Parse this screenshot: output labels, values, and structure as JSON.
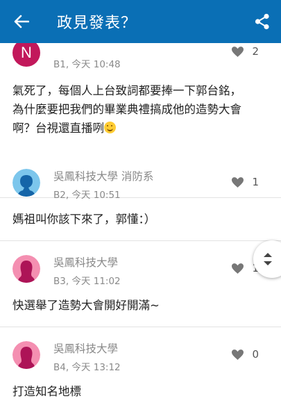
{
  "appbar": {
    "title": "政見發表？",
    "back_icon": "arrow-left-icon",
    "share_icon": "share-icon",
    "color": "#0a6fb5"
  },
  "posts": [
    {
      "avatar_type": "letter",
      "avatar_letter": "N",
      "avatar_color": "#c2185b",
      "author": "",
      "meta": "B1, 今天 10:48",
      "likes": "2",
      "lines": [
        "氣死了，每個人上台致詞都要捧一下郭台銘，",
        "為什麼要把我們的畢業典禮搞成他的造勢大會",
        "啊？台視還直播咧"
      ],
      "emoji": "smiling-face-icon"
    },
    {
      "avatar_type": "male",
      "author": "吳鳳科技大學 消防系",
      "meta": "B2, 今天 10:51",
      "likes": "1",
      "lines": [
        "媽祖叫你該下來了，郭懂：）"
      ]
    },
    {
      "avatar_type": "female",
      "author": "吳鳳科技大學",
      "meta": "B3, 今天 11:02",
      "likes": "1",
      "lines": [
        "快選舉了造勢大會開好開滿~"
      ]
    },
    {
      "avatar_type": "female",
      "author": "吳鳳科技大學",
      "meta": "B4, 今天 13:12",
      "likes": "0",
      "lines": [
        "打造知名地標"
      ]
    }
  ],
  "scroll_fab": {
    "icon": "up-down-arrows-icon"
  }
}
